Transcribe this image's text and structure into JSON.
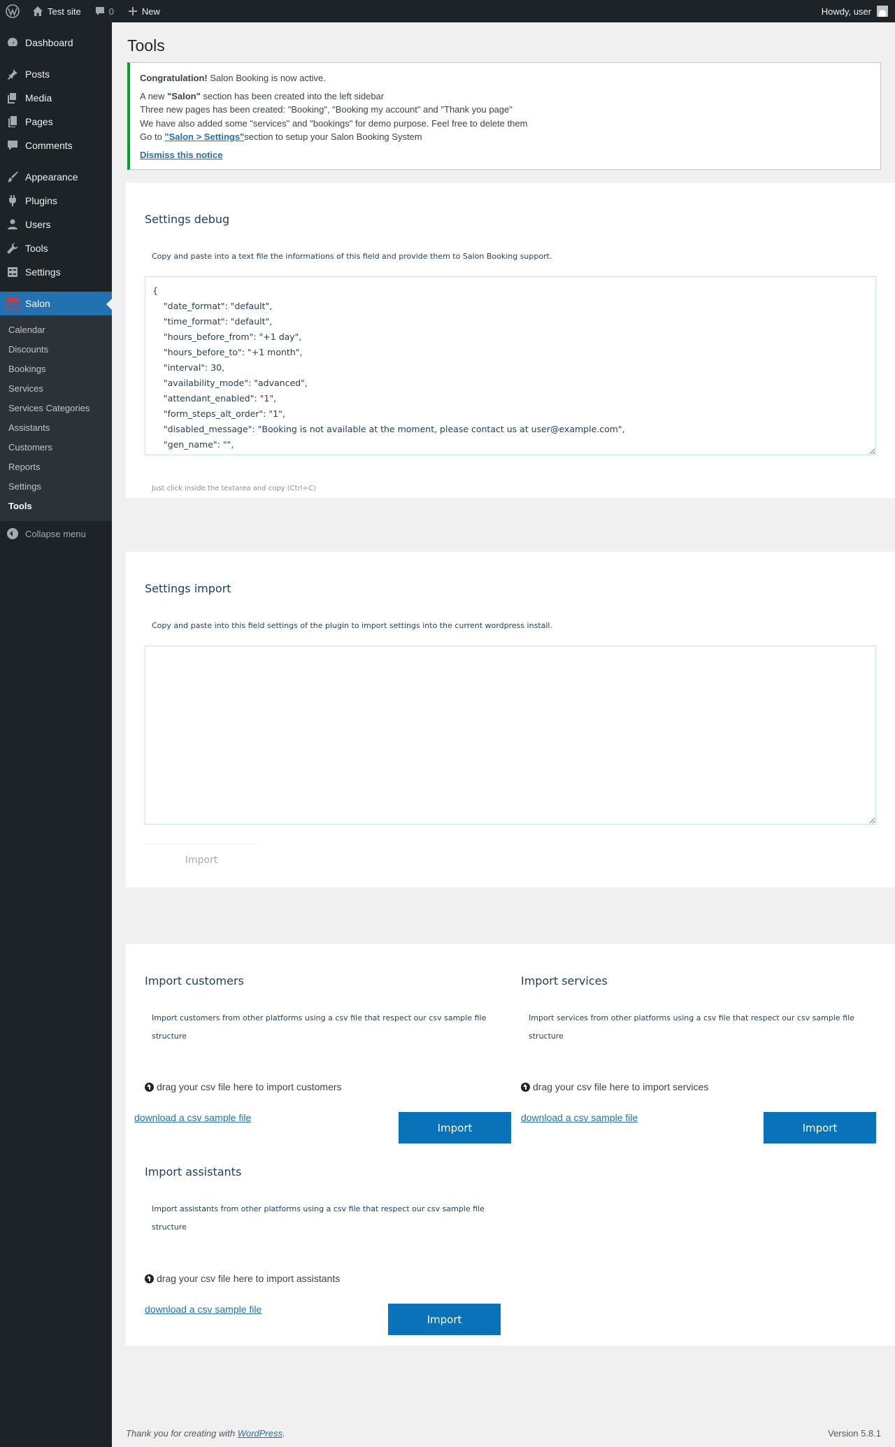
{
  "adminbar": {
    "site_name": "Test site",
    "comments_count": "0",
    "new_label": "New",
    "howdy": "Howdy, user"
  },
  "sidebar": {
    "items": [
      {
        "label": "Dashboard",
        "icon": "dashboard-icon"
      },
      {
        "label": "Posts",
        "icon": "pin-icon"
      },
      {
        "label": "Media",
        "icon": "media-icon"
      },
      {
        "label": "Pages",
        "icon": "pages-icon"
      },
      {
        "label": "Comments",
        "icon": "comment-icon"
      },
      {
        "label": "Appearance",
        "icon": "brush-icon"
      },
      {
        "label": "Plugins",
        "icon": "plug-icon"
      },
      {
        "label": "Users",
        "icon": "user-icon"
      },
      {
        "label": "Tools",
        "icon": "wrench-icon"
      },
      {
        "label": "Settings",
        "icon": "settings-icon"
      },
      {
        "label": "Salon",
        "icon": "calendar-icon"
      }
    ],
    "submenu": [
      "Calendar",
      "Discounts",
      "Bookings",
      "Services",
      "Services Categories",
      "Assistants",
      "Customers",
      "Reports",
      "Settings",
      "Tools"
    ],
    "collapse": "Collapse menu"
  },
  "page": {
    "title": "Tools"
  },
  "notice": {
    "congrats_bold": "Congratulation!",
    "congrats_rest": " Salon Booking is now active.",
    "line1_a": "A new ",
    "line1_b": "\"Salon\"",
    "line1_c": " section has been created into the left sidebar",
    "line2": "Three new pages has been created: \"Booking\", \"Booking my account\" and \"Thank you page\"",
    "line3": "We have also added some \"services\" and \"bookings\" for demo purpose. Feel free to delete them",
    "line4_a": "Go to ",
    "line4_link": "\"Salon > Settings\"",
    "line4_c": "section to setup your Salon Booking System",
    "dismiss": "Dismiss this notice"
  },
  "debug": {
    "title": "Settings debug",
    "desc": "Copy and paste into a text file the informations of this field and provide them to Salon Booking support.",
    "json_text": "{\n    \"date_format\": \"default\",\n    \"time_format\": \"default\",\n    \"hours_before_from\": \"+1 day\",\n    \"hours_before_to\": \"+1 month\",\n    \"interval\": 30,\n    \"availability_mode\": \"advanced\",\n    \"attendant_enabled\": \"1\",\n    \"form_steps_alt_order\": \"1\",\n    \"disabled_message\": \"Booking is not available at the moment, please contact us at user@example.com\",\n    \"gen_name\": \"\",",
    "hint": "Just click inside the textarea and copy (Ctrl+C)"
  },
  "import_settings": {
    "title": "Settings import",
    "desc": "Copy and paste into this field settings of the plugin to import settings into the current wordpress install.",
    "button": "Import"
  },
  "import_customers": {
    "title": "Import customers",
    "desc": "Import customers from other platforms using a csv file that respect our csv sample file structure",
    "drag": "drag your csv file here to import customers",
    "download": "download a csv sample file",
    "button": "Import"
  },
  "import_services": {
    "title": "Import services",
    "desc": "Import services from other platforms using a csv file that respect our csv sample file structure",
    "drag": "drag your csv file here to import services",
    "download": "download a csv sample file",
    "button": "Import"
  },
  "import_assistants": {
    "title": "Import assistants",
    "desc": "Import assistants from other platforms using a csv file that respect our csv sample file structure",
    "drag": "drag your csv file here to import assistants",
    "download": "download a csv sample file",
    "button": "Import"
  },
  "footer": {
    "thanks_a": "Thank you for creating with ",
    "thanks_link": "WordPress",
    "thanks_c": ".",
    "version": "Version 5.8.1"
  },
  "colors": {
    "adminbar_bg": "#1d2327",
    "active_menu": "#2271b1",
    "notice_border": "#00a32a",
    "import_button": "#0a72b9"
  }
}
